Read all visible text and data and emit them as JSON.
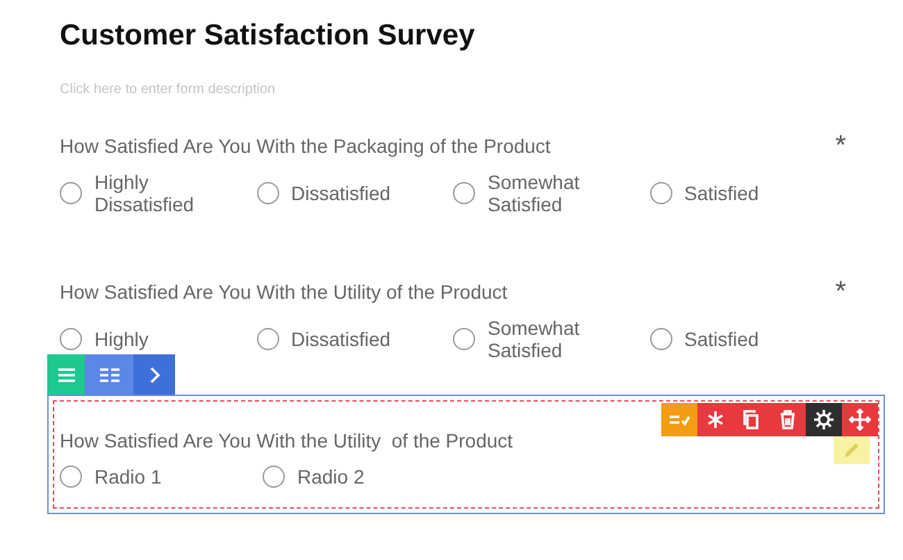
{
  "form": {
    "title": "Customer Satisfaction Survey",
    "description_placeholder": "Click here to enter form description"
  },
  "questions": [
    {
      "text": "How Satisfied Are You With the Packaging of the Product",
      "required_mark": "*",
      "selected": false,
      "options": [
        {
          "label": "Highly Dissatisfied",
          "selected": false
        },
        {
          "label": "Dissatisfied",
          "selected": false
        },
        {
          "label": "Somewhat Satisfied",
          "selected": false
        },
        {
          "label": "Satisfied",
          "selected": false
        }
      ]
    },
    {
      "text": "How Satisfied Are You With the Utility of the Product",
      "required_mark": "*",
      "selected": false,
      "options": [
        {
          "label": "Highly",
          "selected": false
        },
        {
          "label": "Dissatisfied",
          "selected": false
        },
        {
          "label": "Somewhat Satisfied",
          "selected": false
        },
        {
          "label": "Satisfied",
          "selected": false
        }
      ]
    },
    {
      "text": "How Satisfied Are You With the Utility  of the Product",
      "selected": true,
      "options": [
        {
          "label": "Radio 1",
          "selected": false
        },
        {
          "label": "Radio 2",
          "selected": false
        }
      ]
    }
  ]
}
